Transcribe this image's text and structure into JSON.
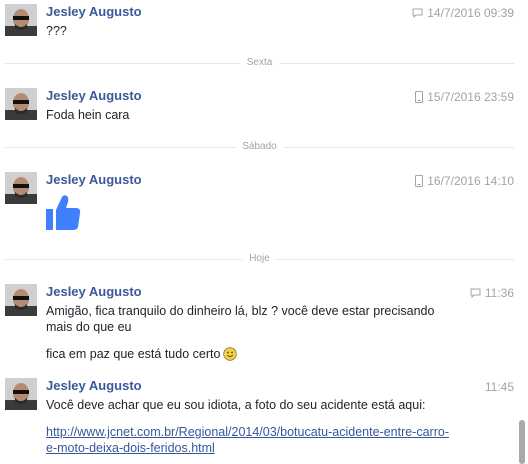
{
  "sender_name": "Jesley Augusto",
  "colors": {
    "name": "#3b5998",
    "link": "#365899",
    "meta": "#a0a4ab",
    "like": "#4080ff"
  },
  "messages": [
    {
      "time": "14/7/2016 09:39",
      "via": "chat-icon",
      "lines": [
        "???"
      ]
    },
    {
      "time": "15/7/2016 23:59",
      "via": "mobile-icon",
      "lines": [
        "Foda hein cara"
      ]
    },
    {
      "time": "16/7/2016 14:10",
      "via": "mobile-icon",
      "sticker": "thumbs-up-icon"
    },
    {
      "time": "11:36",
      "via": "chat-icon",
      "lines": [
        "Amigão, fica tranquilo do dinheiro lá, blz ? você deve estar precisando",
        "mais do que eu",
        "fica em paz que está tudo certo"
      ]
    },
    {
      "time": "11:45",
      "lines": [
        "Você deve achar que eu sou idiota, a foto do seu acidente está aqui:"
      ],
      "link_lines": [
        "http://www.jcnet.com.br/Regional/2014/03/botucatu-acidente-entre-carro-",
        "e-moto-deixa-dois-feridos.html"
      ]
    }
  ],
  "dividers": [
    "Sexta",
    "Sábado",
    "Hoje"
  ]
}
